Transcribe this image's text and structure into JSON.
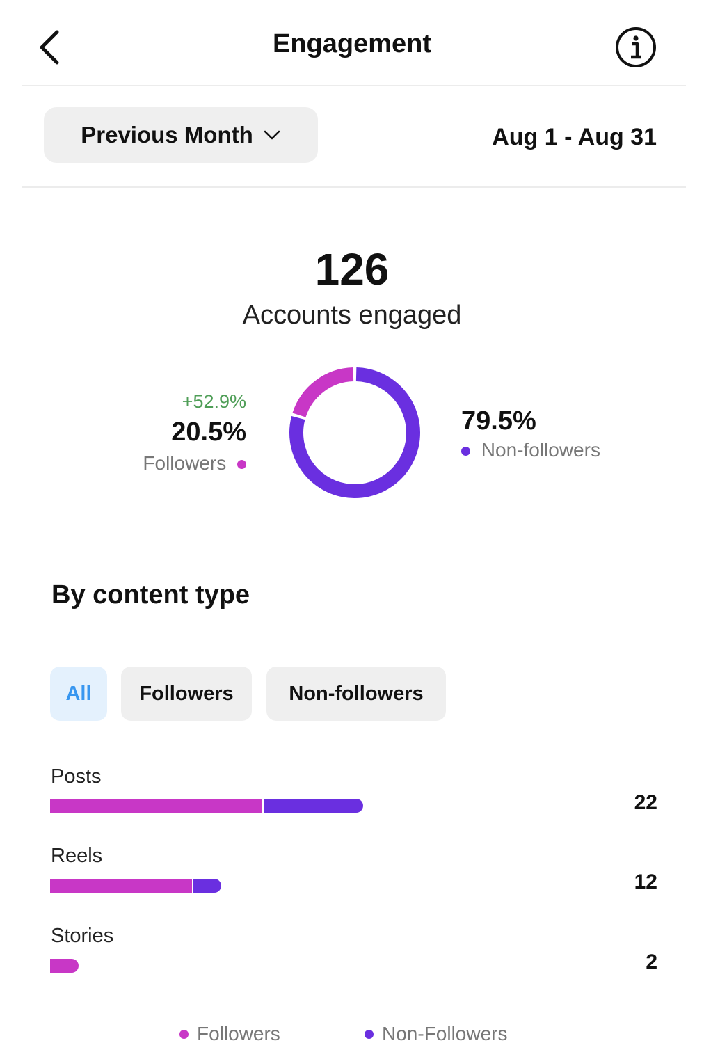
{
  "header": {
    "title": "Engagement",
    "back_icon": "chevron-left-icon",
    "info_icon": "info-icon"
  },
  "period": {
    "selected": "Previous Month",
    "dropdown_icon": "chevron-down-icon",
    "date_range": "Aug 1 - Aug 31"
  },
  "summary": {
    "total": "126",
    "caption": "Accounts engaged",
    "followers": {
      "change": "+52.9%",
      "percent": "20.5%",
      "label": "Followers",
      "share": 0.205
    },
    "non_followers": {
      "percent": "79.5%",
      "label": "Non-followers",
      "share": 0.795
    }
  },
  "colors": {
    "followers": "#c837c6",
    "non_followers": "#6a2fe0",
    "positive_change": "#4f9e57",
    "selected_filter_bg": "#e4f1fd",
    "selected_filter_text": "#3897f0",
    "filter_bg": "#efefef"
  },
  "content_type": {
    "title": "By content type",
    "filters": [
      "All",
      "Followers",
      "Non-followers"
    ],
    "selected_filter": "All",
    "rows": [
      {
        "label": "Posts",
        "count": "22"
      },
      {
        "label": "Reels",
        "count": "12"
      },
      {
        "label": "Stories",
        "count": "2"
      }
    ],
    "legend": [
      "Followers",
      "Non-Followers"
    ]
  },
  "chart_data": {
    "type": "bar",
    "categories": [
      "Posts",
      "Reels",
      "Stories"
    ],
    "stacked": true,
    "orientation": "horizontal",
    "series": [
      {
        "name": "Followers",
        "values": [
          15,
          10,
          2
        ]
      },
      {
        "name": "Non-Followers",
        "values": [
          7,
          2,
          0
        ]
      }
    ],
    "totals": [
      22,
      12,
      2
    ],
    "legend_position": "bottom",
    "grid": false
  }
}
